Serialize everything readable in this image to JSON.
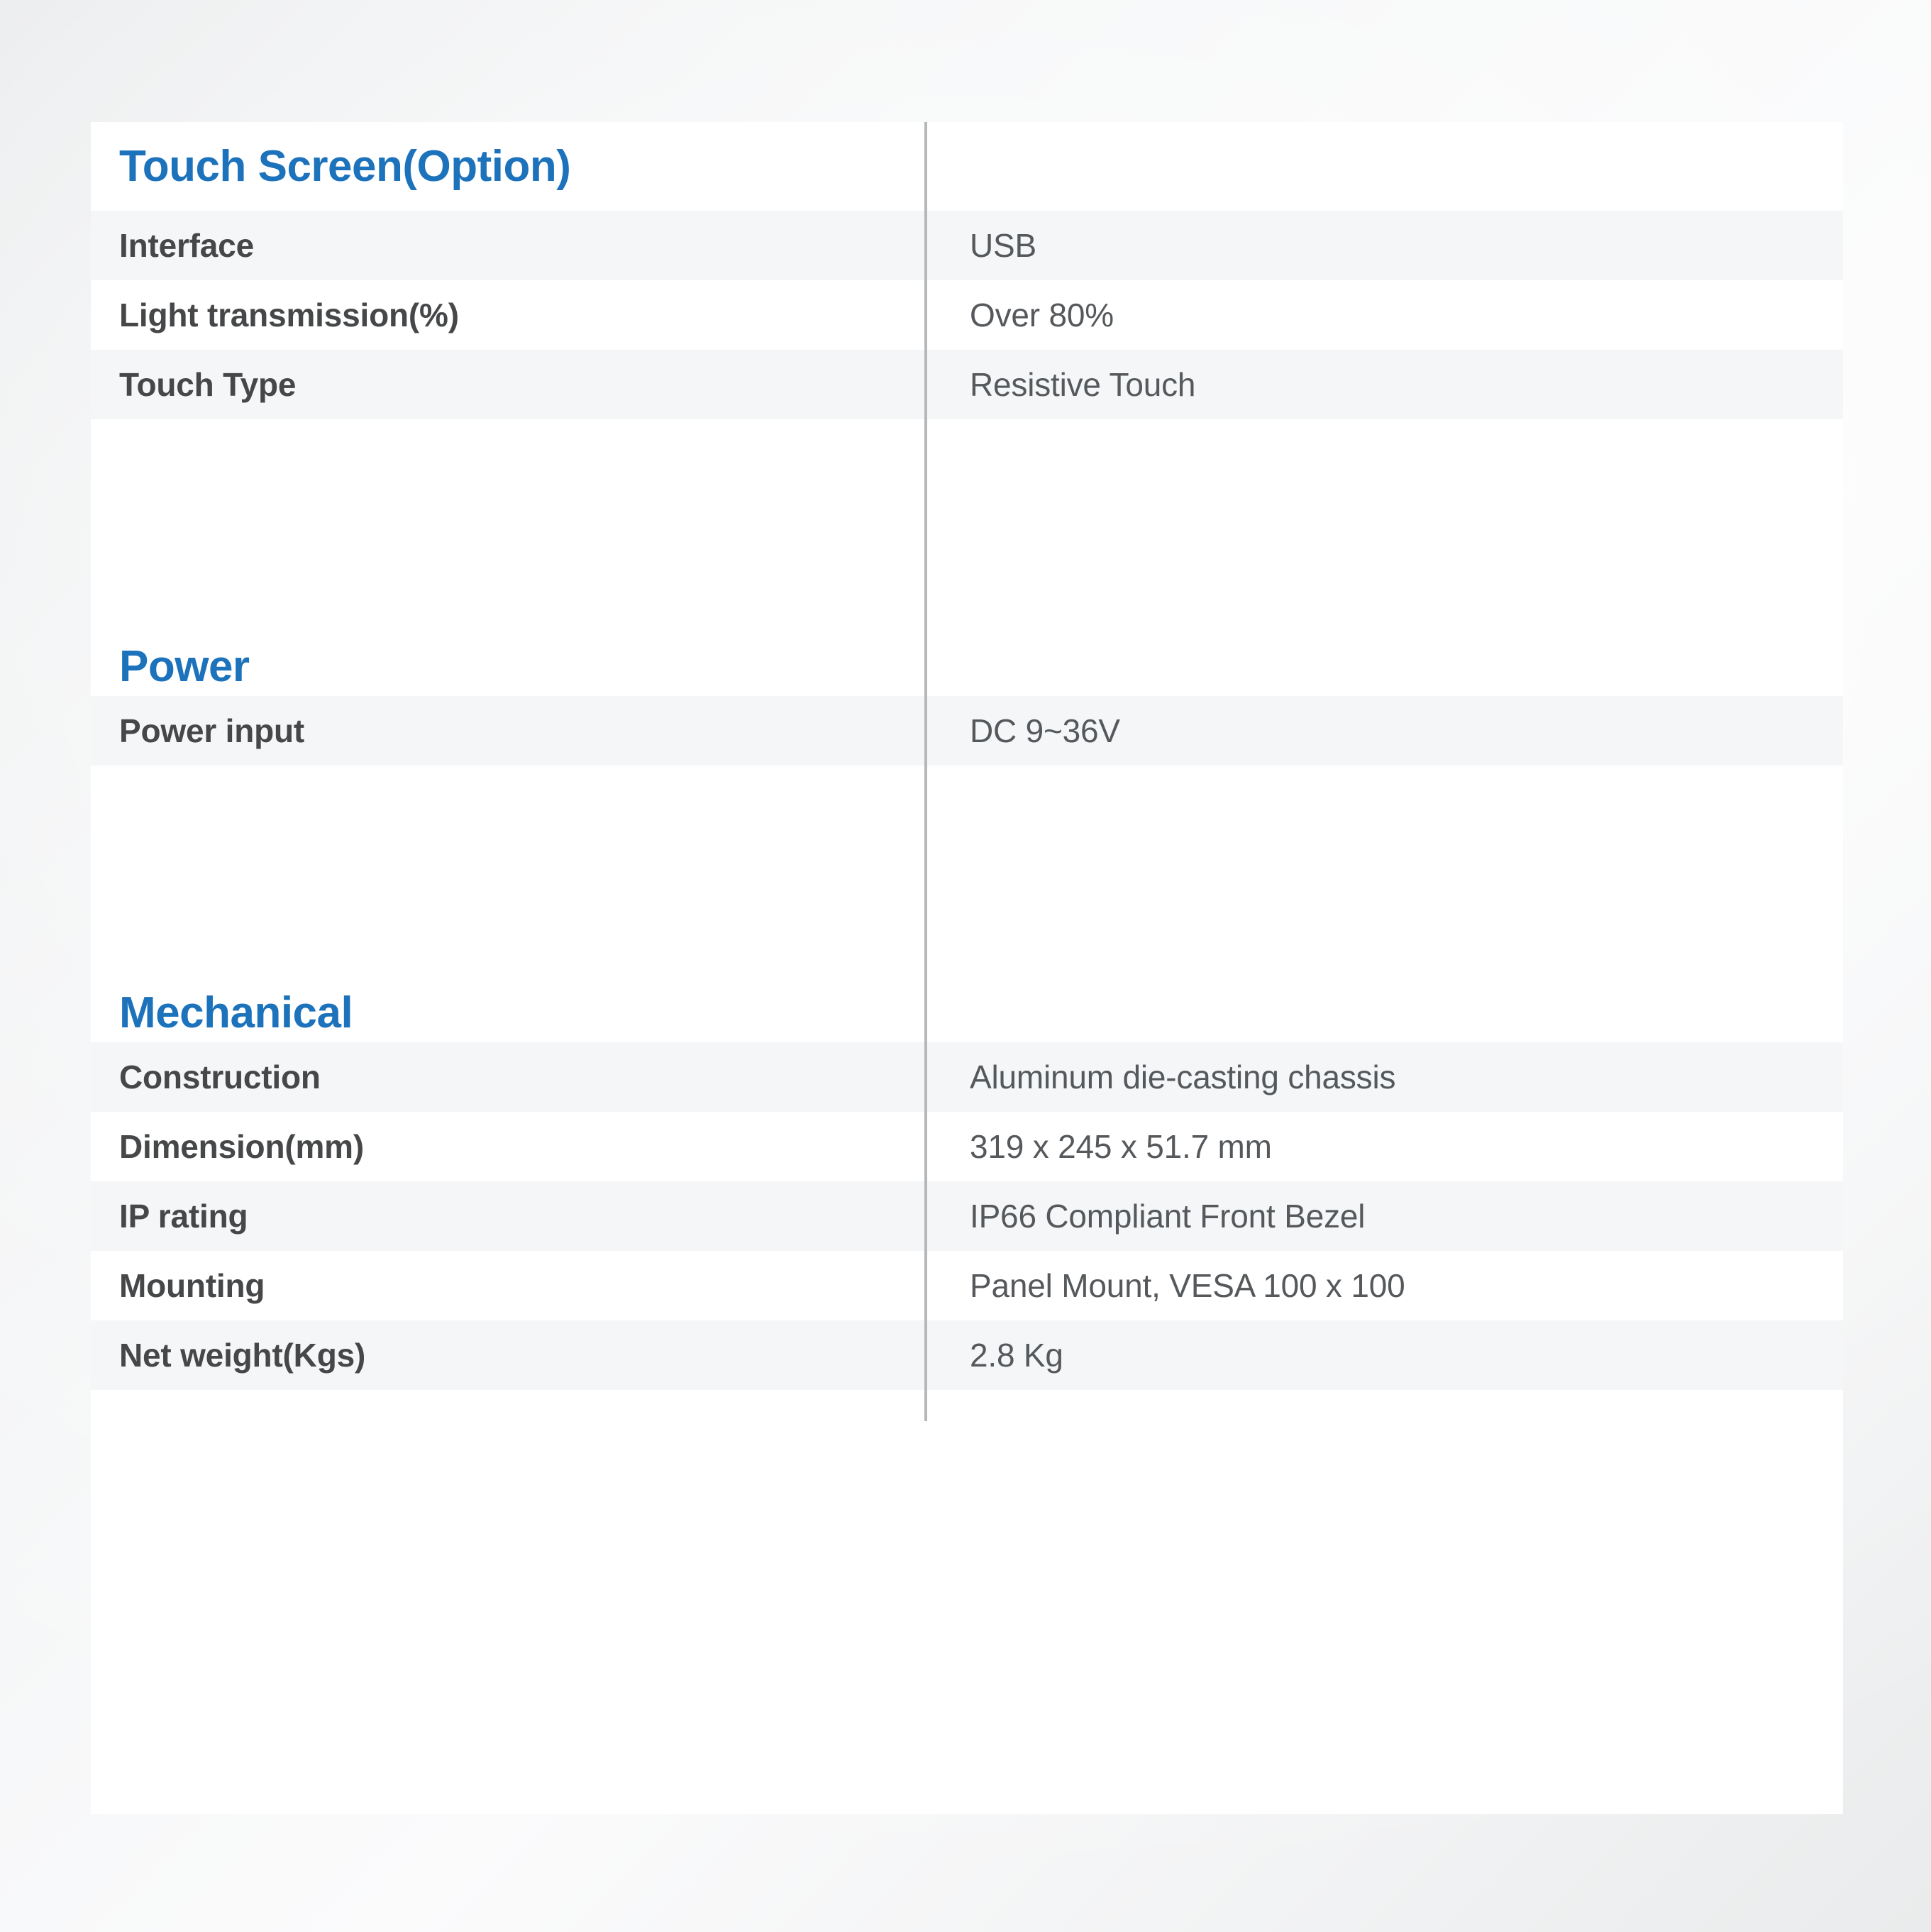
{
  "document": {
    "title": "Product Specification Table",
    "accent_color": "#1c72bb",
    "label_color": "#454749",
    "value_color": "#56595c",
    "shaded_row_color": "#f4f6f8",
    "plain_row_color": "#ffffff",
    "divider_color": "#b5b8bb"
  },
  "sections": [
    {
      "heading": "Touch Screen(Option)",
      "rows": [
        {
          "label": "Interface",
          "value": "USB"
        },
        {
          "label": "Light transmission(%)",
          "value": "Over 80%"
        },
        {
          "label": "Touch Type",
          "value": "Resistive Touch"
        }
      ]
    },
    {
      "heading": "Power",
      "rows": [
        {
          "label": "Power input",
          "value": "DC 9~36V"
        }
      ]
    },
    {
      "heading": "Mechanical",
      "rows": [
        {
          "label": "Construction",
          "value": "Aluminum die-casting chassis"
        },
        {
          "label": "Dimension(mm)",
          "value": "319 x 245 x 51.7 mm"
        },
        {
          "label": "IP rating",
          "value": "IP66 Compliant Front Bezel"
        },
        {
          "label": "Mounting",
          "value": "Panel Mount, VESA 100 x 100"
        },
        {
          "label": "Net weight(Kgs)",
          "value": "2.8 Kg"
        }
      ]
    }
  ]
}
